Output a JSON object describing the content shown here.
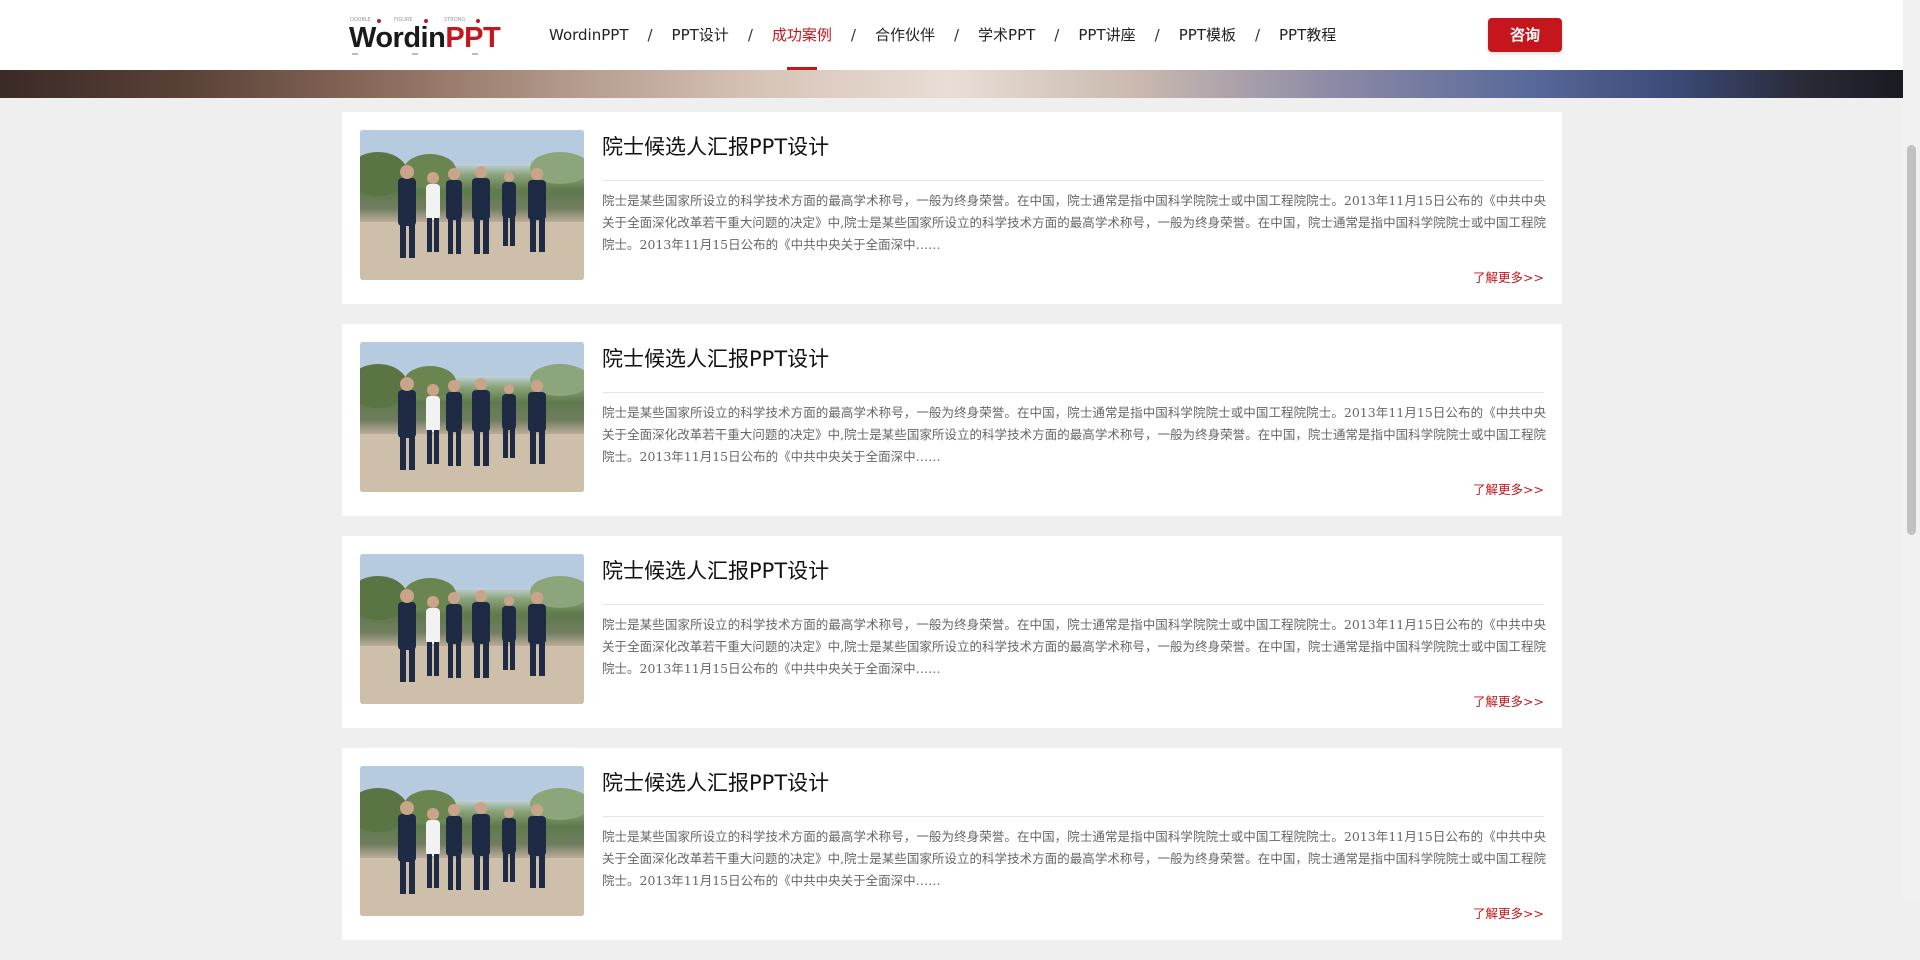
{
  "brand": {
    "logo_word_dark": "Wordin",
    "logo_word_red": "PPT",
    "logo_small_1": "DOUBLE",
    "logo_small_2": "FIGURE",
    "logo_small_3": "STRONG",
    "accent_color": "#c4161c"
  },
  "nav": {
    "items": [
      {
        "label": "WordinPPT",
        "active": false
      },
      {
        "label": "PPT设计",
        "active": false
      },
      {
        "label": "成功案例",
        "active": true
      },
      {
        "label": "合作伙伴",
        "active": false
      },
      {
        "label": "学术PPT",
        "active": false
      },
      {
        "label": "PPT讲座",
        "active": false
      },
      {
        "label": "PPT模板",
        "active": false
      },
      {
        "label": "PPT教程",
        "active": false
      }
    ],
    "separator": "/"
  },
  "consult_button": "咨询",
  "cards": [
    {
      "title": "院士候选人汇报PPT设计",
      "description": "院士是某些国家所设立的科学技术方面的最高学术称号，一般为终身荣誉。在中国，院士通常是指中国科学院院士或中国工程院院士。2013年11月15日公布的《中共中央关于全面深化改革若干重大问题的决定》中,院士是某些国家所设立的科学技术方面的最高学术称号，一般为终身荣誉。在中国，院士通常是指中国科学院院士或中国工程院院士。2013年11月15日公布的《中共中央关于全面深中……",
      "more": "了解更多>>",
      "image_icon": "group-walking-photo"
    },
    {
      "title": "院士候选人汇报PPT设计",
      "description": "院士是某些国家所设立的科学技术方面的最高学术称号，一般为终身荣誉。在中国，院士通常是指中国科学院院士或中国工程院院士。2013年11月15日公布的《中共中央关于全面深化改革若干重大问题的决定》中,院士是某些国家所设立的科学技术方面的最高学术称号，一般为终身荣誉。在中国，院士通常是指中国科学院院士或中国工程院院士。2013年11月15日公布的《中共中央关于全面深中……",
      "more": "了解更多>>",
      "image_icon": "group-walking-photo"
    },
    {
      "title": "院士候选人汇报PPT设计",
      "description": "院士是某些国家所设立的科学技术方面的最高学术称号，一般为终身荣誉。在中国，院士通常是指中国科学院院士或中国工程院院士。2013年11月15日公布的《中共中央关于全面深化改革若干重大问题的决定》中,院士是某些国家所设立的科学技术方面的最高学术称号，一般为终身荣誉。在中国，院士通常是指中国科学院院士或中国工程院院士。2013年11月15日公布的《中共中央关于全面深中……",
      "more": "了解更多>>",
      "image_icon": "group-walking-photo"
    },
    {
      "title": "院士候选人汇报PPT设计",
      "description": "院士是某些国家所设立的科学技术方面的最高学术称号，一般为终身荣誉。在中国，院士通常是指中国科学院院士或中国工程院院士。2013年11月15日公布的《中共中央关于全面深化改革若干重大问题的决定》中,院士是某些国家所设立的科学技术方面的最高学术称号，一般为终身荣誉。在中国，院士通常是指中国科学院院士或中国工程院院士。2013年11月15日公布的《中共中央关于全面深中……",
      "more": "了解更多>>",
      "image_icon": "group-walking-photo"
    }
  ]
}
